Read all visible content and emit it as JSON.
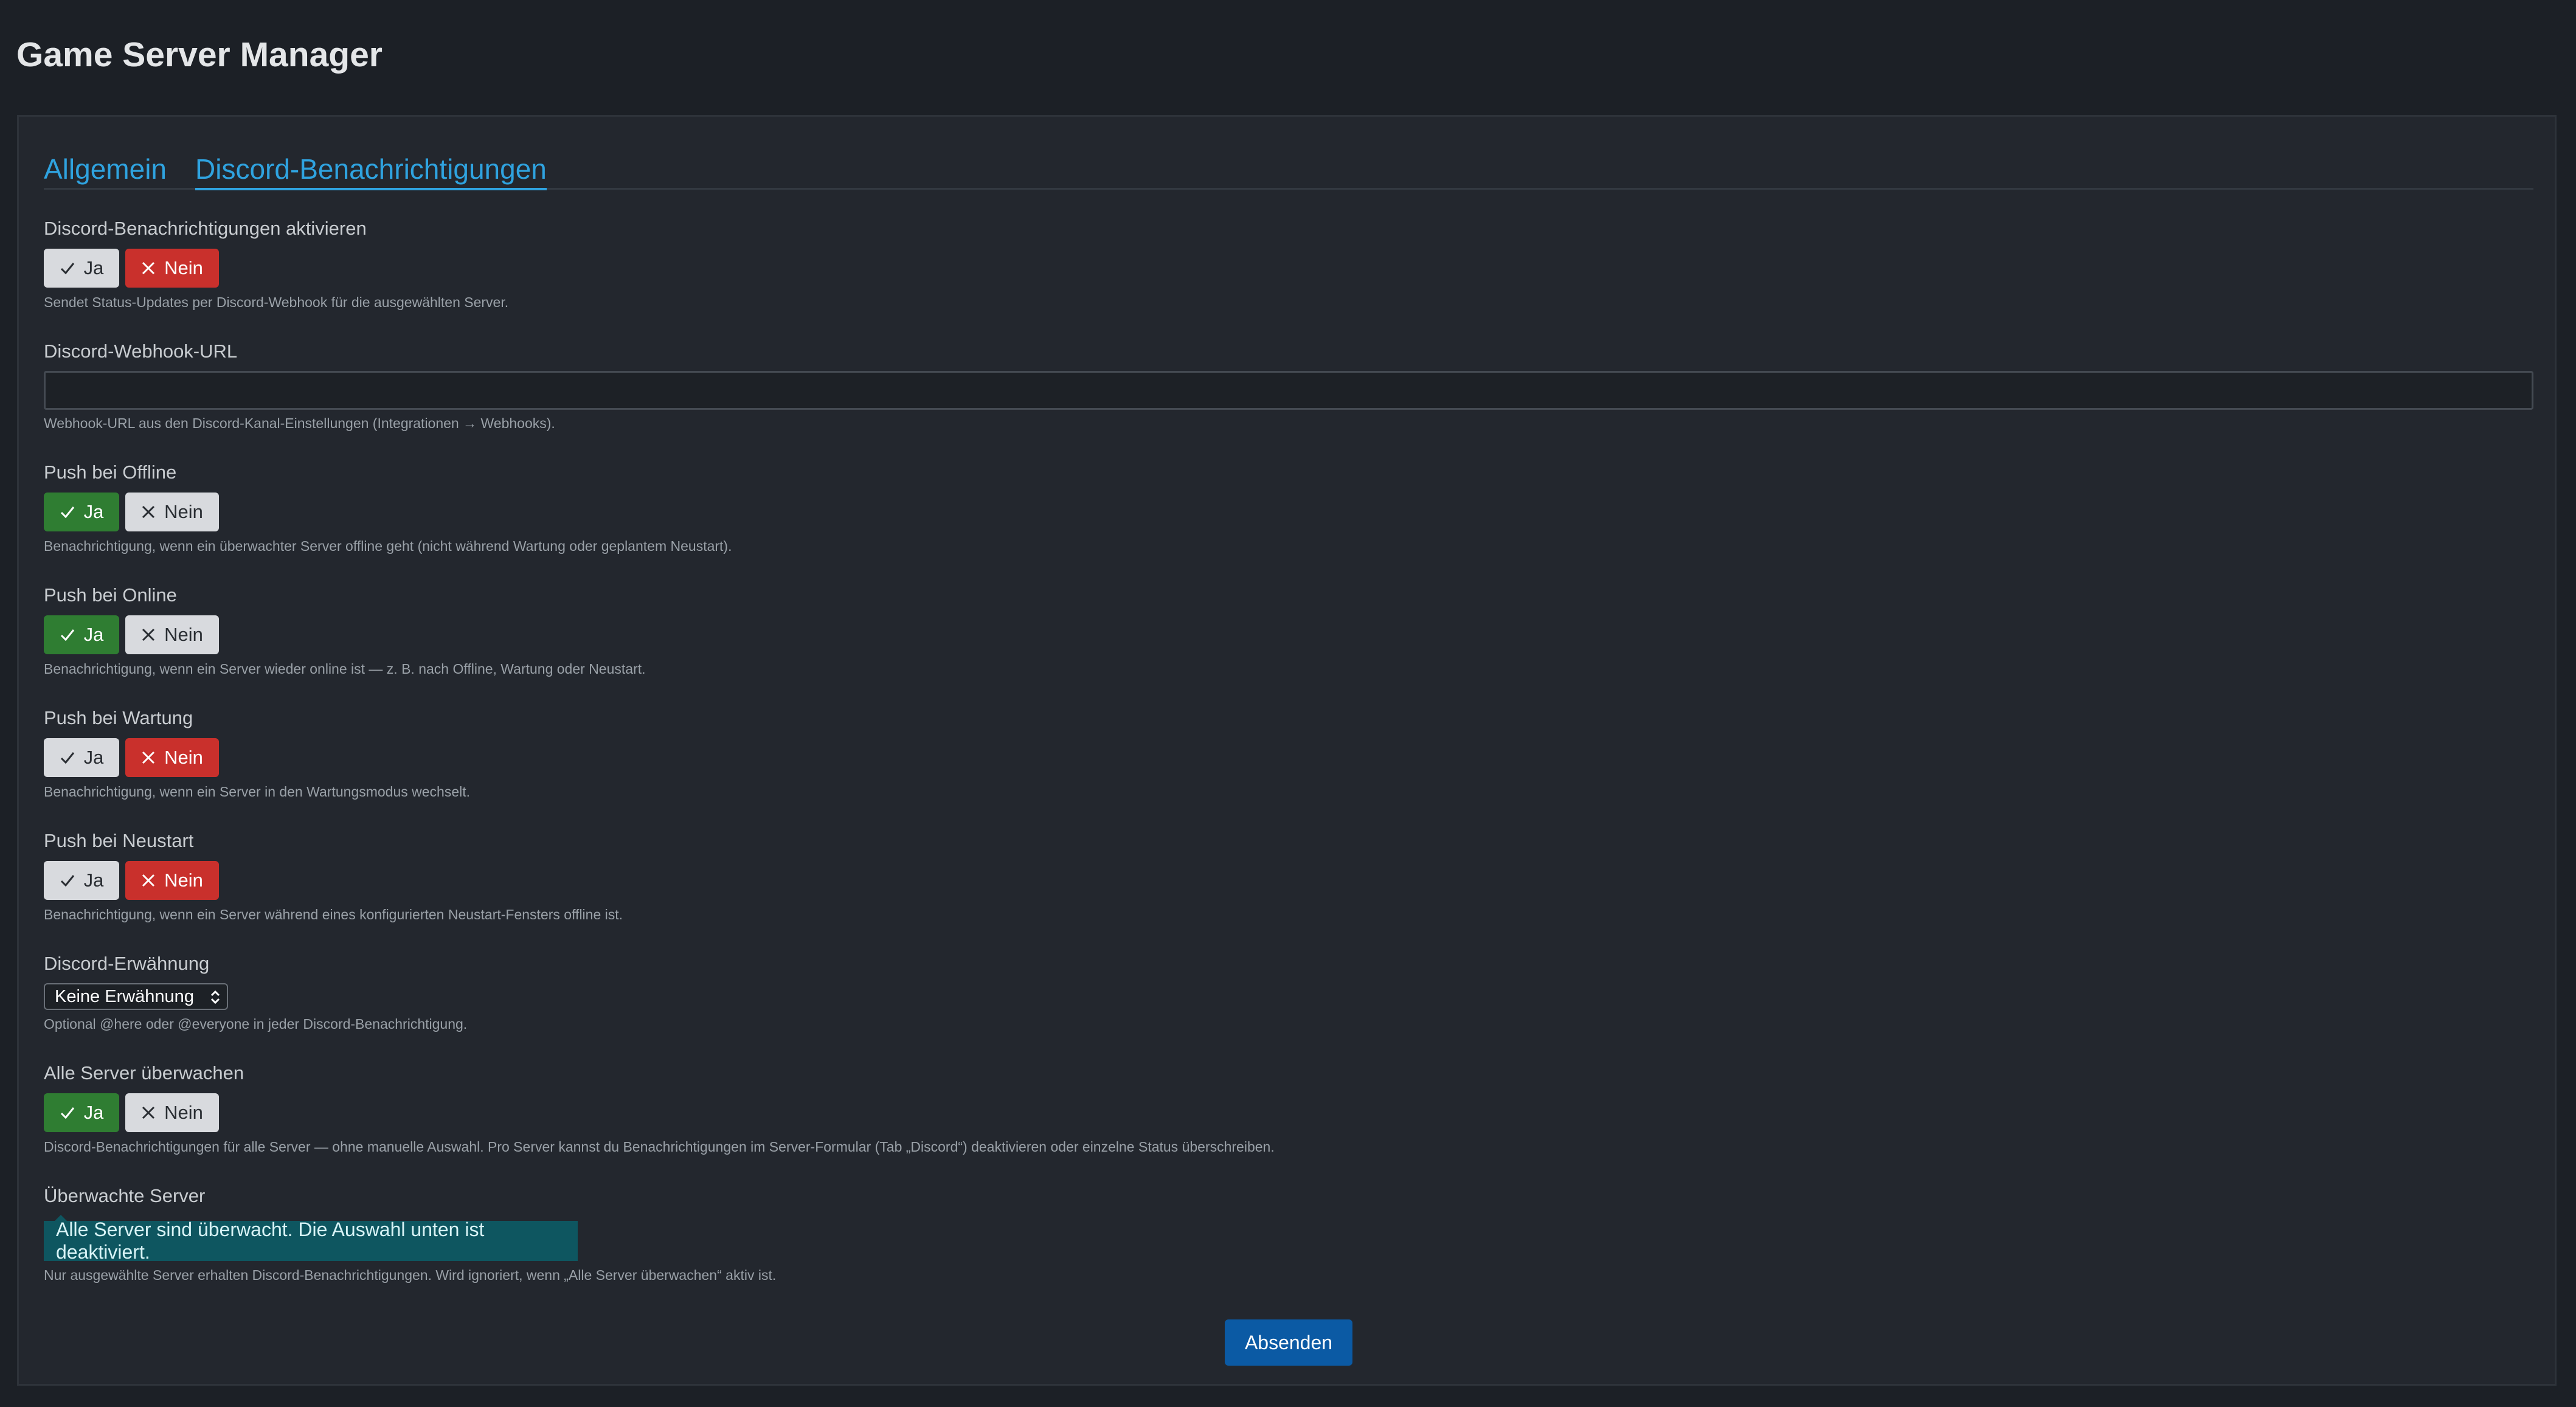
{
  "app": {
    "title": "Game Server Manager"
  },
  "tabs": [
    {
      "label": "Allgemein"
    },
    {
      "label": "Discord-Benachrichtigungen"
    }
  ],
  "fields": {
    "enable": {
      "label": "Discord-Benachrichtigungen aktivieren",
      "help": "Sendet Status-Updates per Discord-Webhook für die ausgewählten Server.",
      "selected": "Nein"
    },
    "webhook": {
      "label": "Discord-Webhook-URL",
      "value": "",
      "help": "Webhook-URL aus den Discord-Kanal-Einstellungen (Integrationen → Webhooks)."
    },
    "offline": {
      "label": "Push bei Offline",
      "help": "Benachrichtigung, wenn ein überwachter Server offline geht (nicht während Wartung oder geplantem Neustart).",
      "selected": "Ja"
    },
    "online": {
      "label": "Push bei Online",
      "help": "Benachrichtigung, wenn ein Server wieder online ist — z. B. nach Offline, Wartung oder Neustart.",
      "selected": "Ja"
    },
    "maintenance": {
      "label": "Push bei Wartung",
      "help": "Benachrichtigung, wenn ein Server in den Wartungsmodus wechselt.",
      "selected": "Nein"
    },
    "restart": {
      "label": "Push bei Neustart",
      "help": "Benachrichtigung, wenn ein Server während eines konfigurierten Neustart-Fensters offline ist.",
      "selected": "Nein"
    },
    "mention": {
      "label": "Discord-Erwähnung",
      "selected_option": "Keine Erwähnung",
      "help": "Optional @here oder @everyone in jeder Discord-Benachrichtigung."
    },
    "all_servers": {
      "label": "Alle Server überwachen",
      "help": "Discord-Benachrichtigungen für alle Server — ohne manuelle Auswahl. Pro Server kannst du Benachrichtigungen im Server-Formular (Tab „Discord“) deaktivieren oder einzelne Status überschreiben.",
      "selected": "Ja"
    },
    "watched": {
      "label": "Überwachte Server",
      "banner": "Alle Server sind überwacht. Die Auswahl unten ist deaktiviert.",
      "help": "Nur ausgewählte Server erhalten Discord-Benachrichtigungen. Wird ignoriert, wenn „Alle Server überwachen“ aktiv ist."
    }
  },
  "toggle_labels": {
    "yes": "Ja",
    "no": "Nein"
  },
  "submit_label": "Absenden",
  "colors": {
    "background": "#1c2026",
    "panel": "#23272e",
    "accent": "#2fa3e0",
    "yes_active": "#2f7d32",
    "no_active": "#c9302c",
    "inactive": "#d8dade",
    "info": "#0e5660",
    "primary": "#0b5aa4"
  },
  "icons": {
    "yes": "check-icon",
    "no": "x-icon",
    "select": "chevron-up-down-icon"
  }
}
